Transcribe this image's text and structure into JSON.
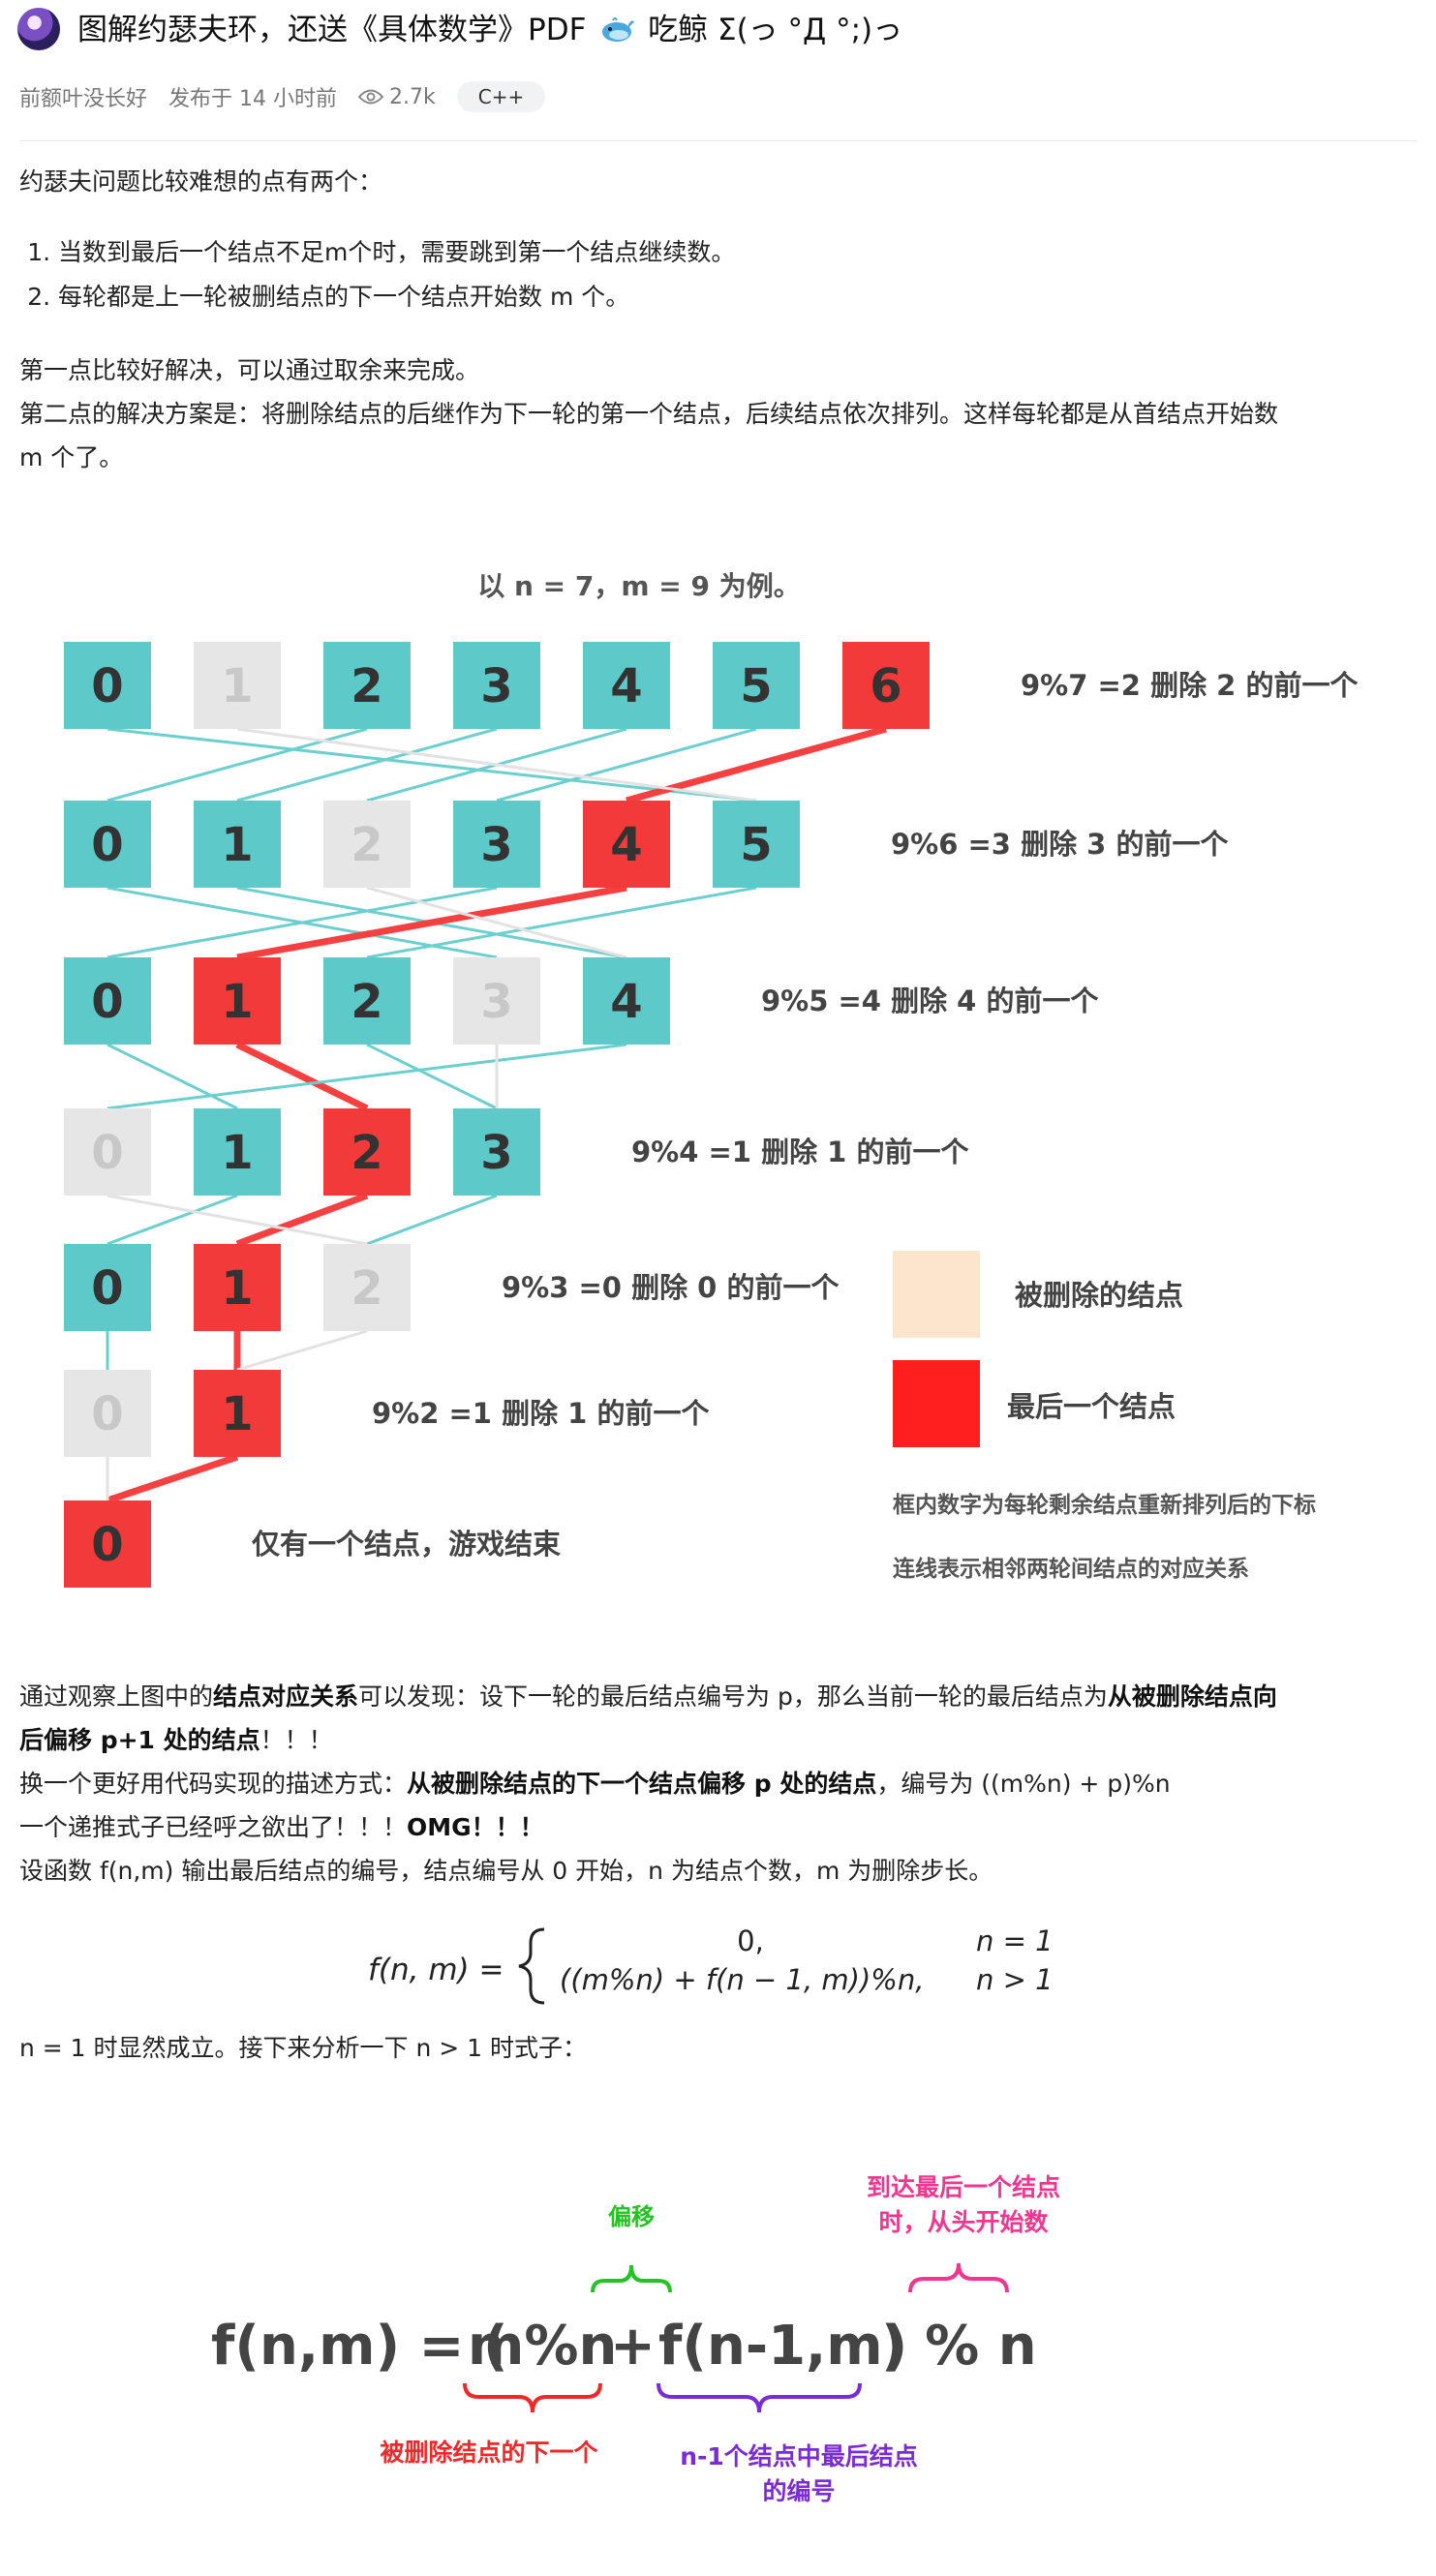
{
  "header": {
    "title_main": "图解约瑟夫环，还送《具体数学》PDF",
    "title_tail": "吃鲸 Σ(っ °Д °;)っ",
    "author": "前额叶没长好",
    "published": "发布于 14 小时前",
    "views": "2.7k",
    "tag": "C++",
    "icons": [
      "avatar-icon",
      "whale-emoji-icon",
      "eye-icon"
    ]
  },
  "intro": {
    "lead": "约瑟夫问题比较难想的点有两个：",
    "items": [
      "当数到最后一个结点不足m个时，需要跳到第一个结点继续数。",
      "每轮都是上一轮被删结点的下一个结点开始数 m 个。"
    ],
    "p1": "第一点比较好解决，可以通过取余来完成。",
    "p2a": "第二点的解决方案是：将删除结点的后继作为下一轮的第一个结点，后续结点依次排列。这样每轮都是从首结点开始数",
    "p2b": "m 个了。"
  },
  "diagram": {
    "caption": "以 n = 7，m = 9 为例。",
    "colors": {
      "alive": "#5ec9c9",
      "deleted": "#e6e6e6",
      "last": "#f23a3a",
      "legend_deleted": "#fde4cc",
      "legend_last": "#ff1f1f",
      "line": "#6ccfcf",
      "last_line": "#f44040"
    },
    "rows": [
      {
        "nodes": [
          {
            "v": "0",
            "s": "alive"
          },
          {
            "v": "1",
            "s": "deleted"
          },
          {
            "v": "2",
            "s": "alive"
          },
          {
            "v": "3",
            "s": "alive"
          },
          {
            "v": "4",
            "s": "alive"
          },
          {
            "v": "5",
            "s": "alive"
          },
          {
            "v": "6",
            "s": "last"
          }
        ],
        "label": "9%7 =2 删除 2 的前一个"
      },
      {
        "nodes": [
          {
            "v": "0",
            "s": "alive"
          },
          {
            "v": "1",
            "s": "alive"
          },
          {
            "v": "2",
            "s": "deleted"
          },
          {
            "v": "3",
            "s": "alive"
          },
          {
            "v": "4",
            "s": "last"
          },
          {
            "v": "5",
            "s": "alive"
          }
        ],
        "label": "9%6 =3 删除 3 的前一个"
      },
      {
        "nodes": [
          {
            "v": "0",
            "s": "alive"
          },
          {
            "v": "1",
            "s": "last"
          },
          {
            "v": "2",
            "s": "alive"
          },
          {
            "v": "3",
            "s": "deleted"
          },
          {
            "v": "4",
            "s": "alive"
          }
        ],
        "label": "9%5 =4 删除 4 的前一个"
      },
      {
        "nodes": [
          {
            "v": "0",
            "s": "deleted"
          },
          {
            "v": "1",
            "s": "alive"
          },
          {
            "v": "2",
            "s": "last"
          },
          {
            "v": "3",
            "s": "alive"
          }
        ],
        "label": "9%4 =1 删除 1 的前一个"
      },
      {
        "nodes": [
          {
            "v": "0",
            "s": "alive"
          },
          {
            "v": "1",
            "s": "last"
          },
          {
            "v": "2",
            "s": "deleted"
          }
        ],
        "label": "9%3 =0 删除 0 的前一个"
      },
      {
        "nodes": [
          {
            "v": "0",
            "s": "deleted"
          },
          {
            "v": "1",
            "s": "last"
          }
        ],
        "label": "9%2 =1 删除 1 的前一个"
      },
      {
        "nodes": [
          {
            "v": "0",
            "s": "last"
          }
        ],
        "label": "仅有一个结点，游戏结束"
      }
    ],
    "legend": {
      "deleted": "被删除的结点",
      "last": "最后一个结点",
      "note1": "框内数字为每轮剩余结点重新排列后的下标",
      "note2": "连线表示相邻两轮间结点的对应关系"
    }
  },
  "analysis": {
    "l1_a": "通过观察上图中的",
    "l1_b": "结点对应关系",
    "l1_c": "可以发现：设下一轮的最后结点编号为 p，那么当前一轮的最后结点为",
    "l1_d": "从被删除结点向",
    "l2_a": "后偏移 p+1 处的结点",
    "l2_b": "！！！",
    "l3_a": "换一个更好用代码实现的描述方式：",
    "l3_b": "从被删除结点的下一个结点偏移 p 处的结点",
    "l3_c": "，编号为 ((m%n) + p)%n",
    "l4_a": "一个递推式子已经呼之欲出了！！！",
    "l4_b": "OMG！！！",
    "l5": "设函数 f(n,m) 输出最后结点的编号，结点编号从 0 开始，n 为结点个数，m 为删除步长。"
  },
  "formula": {
    "lhs": "f(n, m) =",
    "case1_expr": "0,",
    "case1_cond": "n = 1",
    "case2_expr": "((m%n) + f(n − 1, m))%n,",
    "case2_cond": "n > 1"
  },
  "after_formula": "n = 1 时显然成立。接下来分析一下 n > 1 时式子：",
  "annotated": {
    "expr_prefix": "f(n,m) = (",
    "expr_a": "m%n",
    "expr_plus": "+",
    "expr_b": "f(n-1,m)",
    "expr_suffix": ") % n",
    "offset_label": "偏移",
    "wrap_label_1": "到达最后一个结点",
    "wrap_label_2": "时，从头开始数",
    "next_label": "被删除结点的下一个",
    "sub_label_1": "n-1个结点中最后结点",
    "sub_label_2": "的编号",
    "colors": {
      "offset": "#22c322",
      "wrap": "#f0368f",
      "next": "#f02828",
      "sub": "#7a2bd6"
    }
  }
}
